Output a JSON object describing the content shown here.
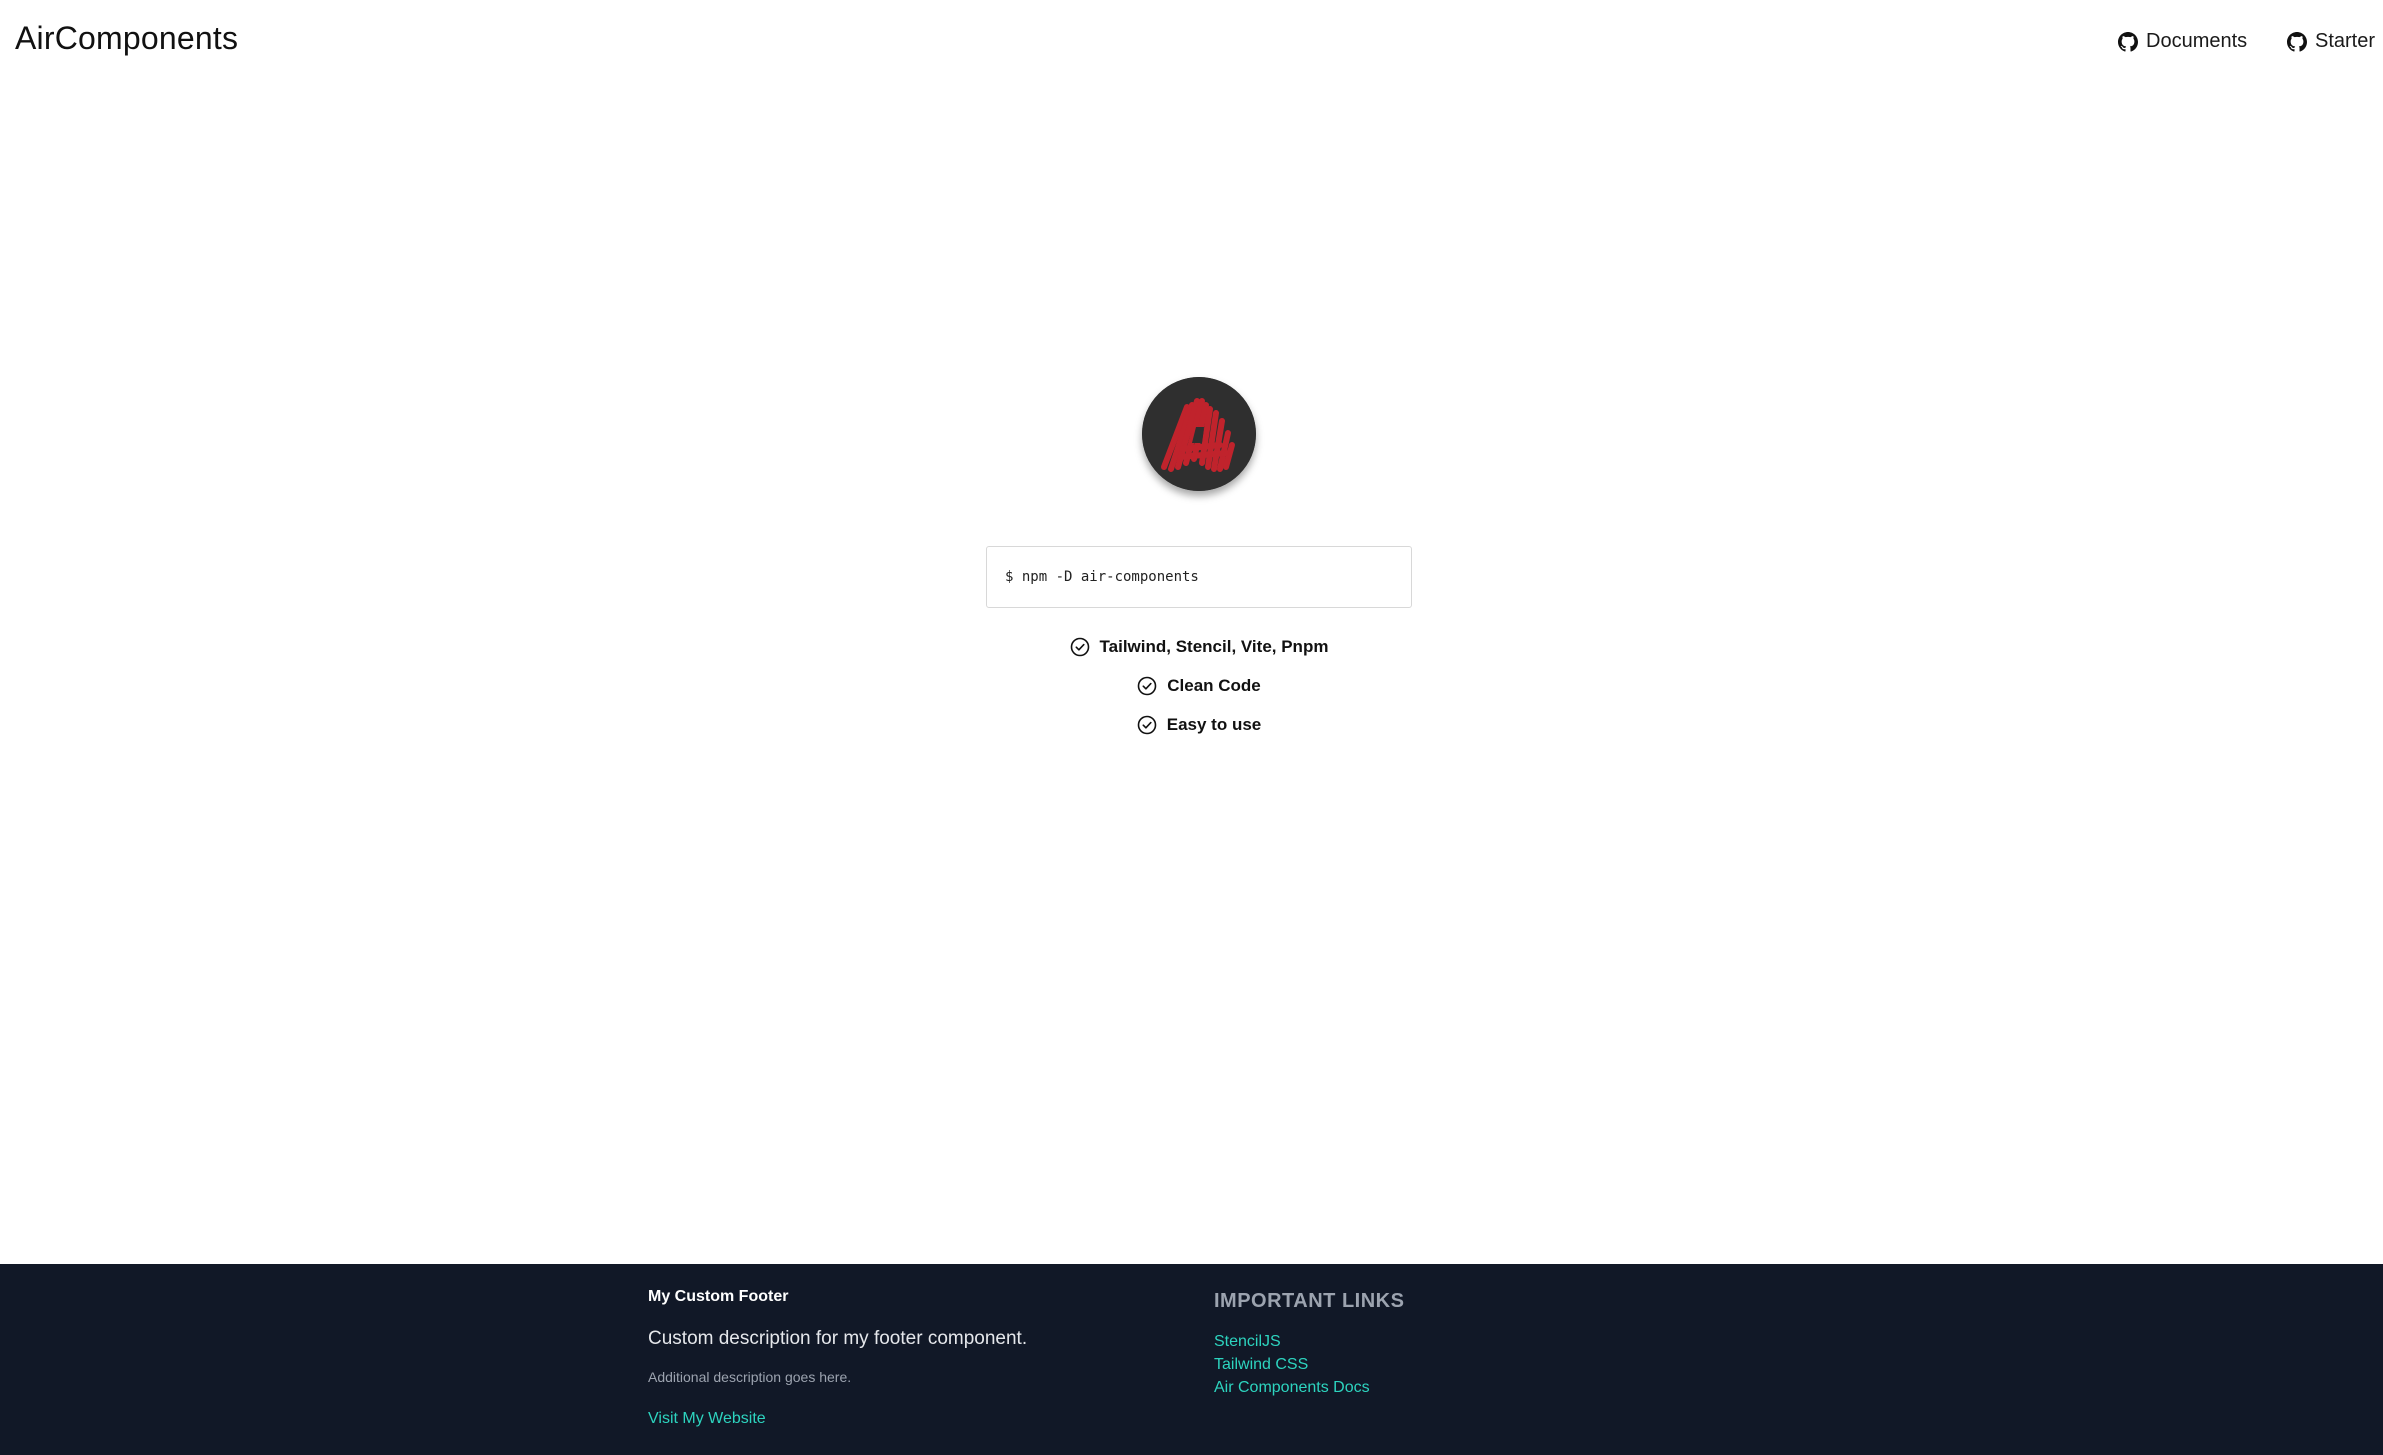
{
  "header": {
    "brand": "AirComponents",
    "nav": [
      {
        "label": "Documents",
        "icon": "github-icon"
      },
      {
        "label": "Starter",
        "icon": "github-icon"
      }
    ]
  },
  "hero": {
    "logo_icon": "air-components-logo",
    "install_command": "$ npm -D air-components",
    "features": [
      {
        "label": "Tailwind, Stencil, Vite, Pnpm",
        "icon": "check-circle-icon"
      },
      {
        "label": "Clean Code",
        "icon": "check-circle-icon"
      },
      {
        "label": "Easy to use",
        "icon": "check-circle-icon"
      }
    ]
  },
  "footer": {
    "title": "My Custom Footer",
    "description": "Custom description for my footer component.",
    "additional": "Additional description goes here.",
    "visit_link": "Visit My Website",
    "links_heading": "IMPORTANT LINKS",
    "links": [
      "StencilJS",
      "Tailwind CSS",
      "Air Components Docs"
    ]
  },
  "colors": {
    "footer_bg": "#111827",
    "link_accent": "#2dd4bf",
    "logo_red": "#c0232c",
    "logo_bg": "#2f2f2f"
  }
}
